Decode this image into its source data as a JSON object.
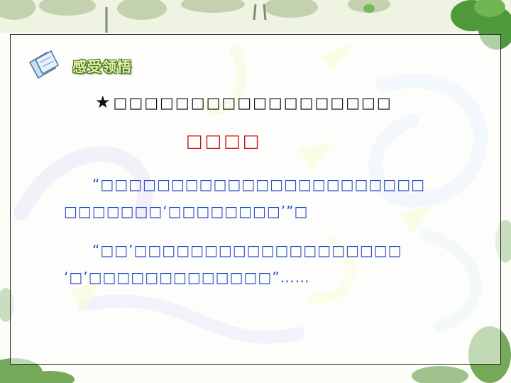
{
  "section": {
    "heading": "感受领悟"
  },
  "prompt": {
    "star": "★",
    "text": "□□□□□□□□□□□□□□□□□□"
  },
  "answer_title": "□□□□",
  "paragraphs": [
    {
      "lines": [
        "“□□□□□□□□□□□□□□□□□□□□□□□",
        "□□□□□□□‘□□□□□□□□’”□"
      ]
    },
    {
      "lines": [
        "“□□’□□□□□□□□□□□□□□□□□□□",
        "‘□’□□□□□□□□□□□□□”……"
      ]
    }
  ],
  "colors": {
    "prompt": "#111111",
    "answer_title": "#cc1111",
    "paragraph": "#2a4fc9",
    "heading": "#e5f2a6"
  }
}
